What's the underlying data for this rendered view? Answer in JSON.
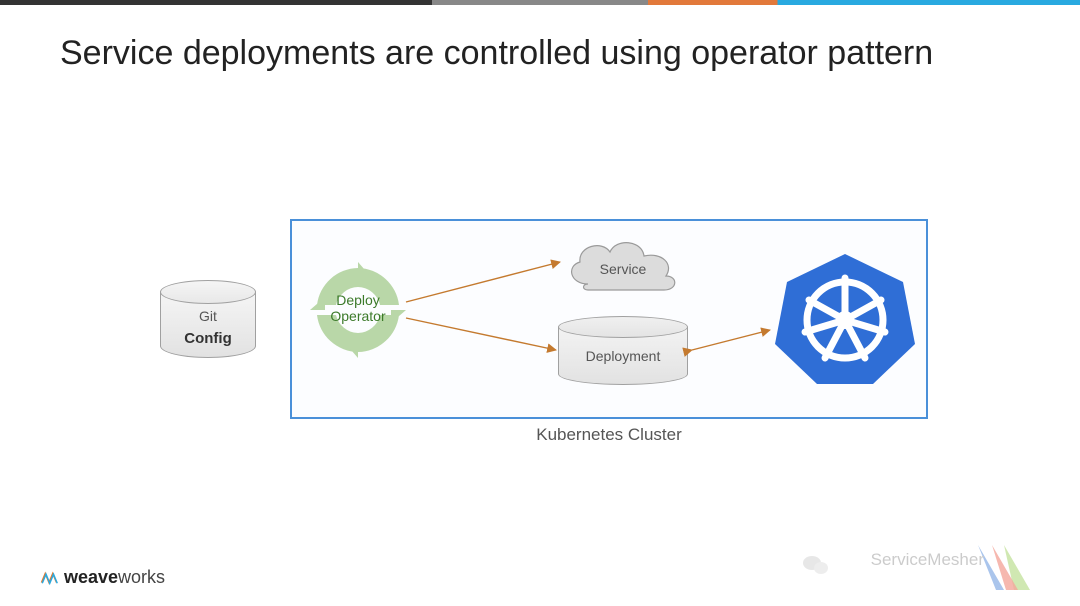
{
  "title": "Service deployments are controlled using operator pattern",
  "git": {
    "line1": "Git",
    "line2": "Config"
  },
  "operator": {
    "line1": "Deploy",
    "line2": "Operator"
  },
  "service": "Service",
  "deployment": "Deployment",
  "cluster_label": "Kubernetes Cluster",
  "footer_brand_bold": "weave",
  "footer_brand_rest": "works",
  "watermark_text": "ServiceMesher"
}
